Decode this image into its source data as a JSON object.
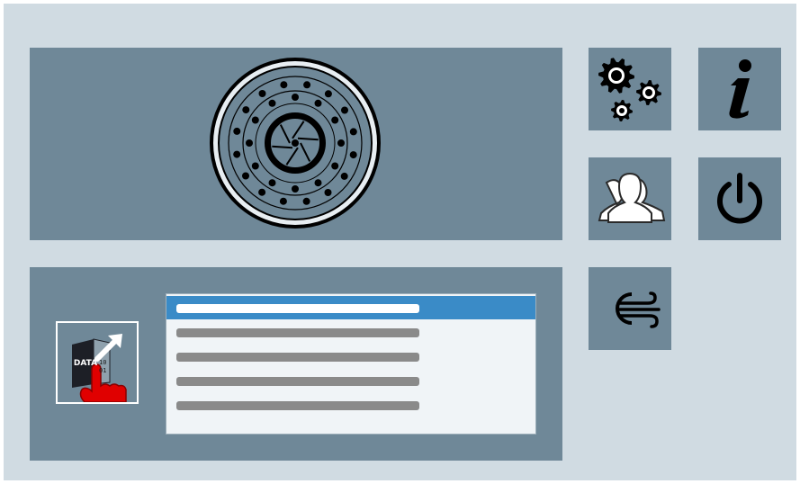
{
  "panels": {
    "camera_panel": {
      "icon": "camera-aperture-icon"
    },
    "data_panel": {
      "data_button": {
        "icon": "data-export-touch-icon",
        "label": "DATA",
        "bits": [
          "10",
          "01"
        ]
      },
      "list_rows": [
        {
          "selected": true
        },
        {
          "selected": false
        },
        {
          "selected": false
        },
        {
          "selected": false
        },
        {
          "selected": false
        }
      ]
    }
  },
  "toolbar": {
    "tiles": [
      {
        "id": "settings",
        "icon": "gears-icon"
      },
      {
        "id": "info",
        "icon": "info-icon"
      },
      {
        "id": "users",
        "icon": "users-icon"
      },
      {
        "id": "power",
        "icon": "power-icon"
      },
      {
        "id": "air",
        "icon": "air-wind-icon"
      }
    ]
  },
  "colors": {
    "background": "#d0dbe2",
    "panel": "#6f8898",
    "selection": "#3a8bc7",
    "list_background": "#f0f4f7",
    "placeholder_bar": "#8a8a8a",
    "hand": "#e00000"
  }
}
